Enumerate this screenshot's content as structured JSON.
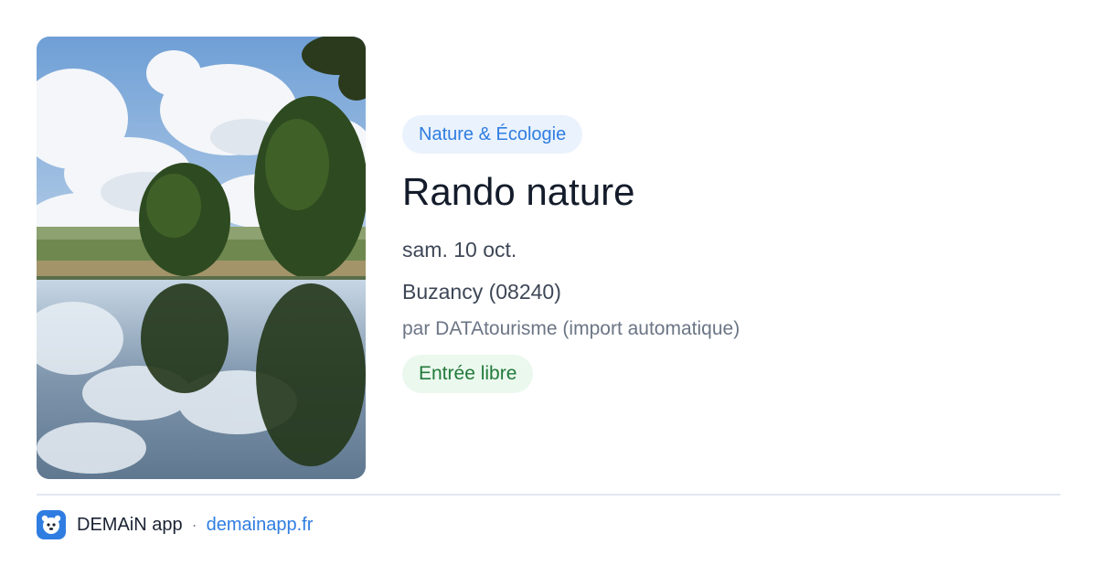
{
  "event": {
    "category": "Nature & Écologie",
    "title": "Rando nature",
    "date": "sam. 10 oct.",
    "location": "Buzancy (08240)",
    "organizer": "par DATAtourisme (import automatique)",
    "price": "Entrée libre"
  },
  "footer": {
    "app_name": "DEMAiN app",
    "separator": "·",
    "link_text": "demainapp.fr"
  },
  "colors": {
    "accent": "#2f7de1",
    "category_bg": "#eaf2fd",
    "price_bg": "#ebf8ee",
    "price_text": "#217a3a"
  },
  "icons": {
    "app_logo": "demain-logo-icon"
  }
}
